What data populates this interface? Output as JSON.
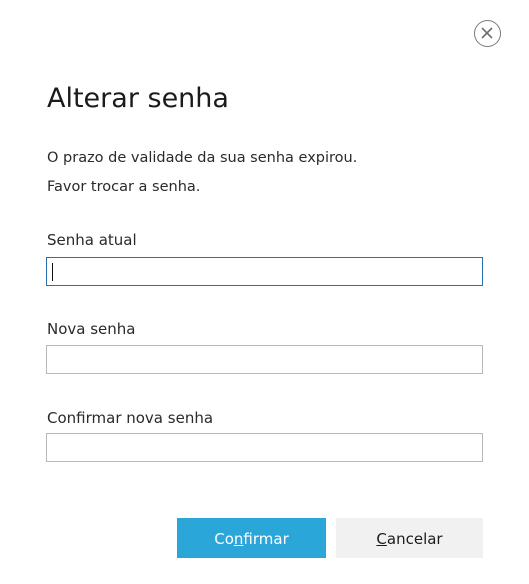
{
  "dialog": {
    "title": "Alterar senha",
    "message_line1": "O prazo de validade da sua senha expirou.",
    "message_line2": "Favor trocar a senha.",
    "close_icon": "close-circle-icon"
  },
  "fields": {
    "current": {
      "label": "Senha atual",
      "value": ""
    },
    "new": {
      "label": "Nova senha",
      "value": ""
    },
    "confirm": {
      "label": "Confirmar nova senha",
      "value": ""
    }
  },
  "buttons": {
    "confirm": {
      "label": "Confirmar",
      "before": "Co",
      "mnemonic": "n",
      "after": "firmar"
    },
    "cancel": {
      "label": "Cancelar",
      "before": "",
      "mnemonic": "C",
      "after": "ancelar"
    }
  },
  "colors": {
    "primary": "#2aa6d9",
    "secondary_bg": "#f1f1f1",
    "focus_border": "#2a6fb0"
  }
}
